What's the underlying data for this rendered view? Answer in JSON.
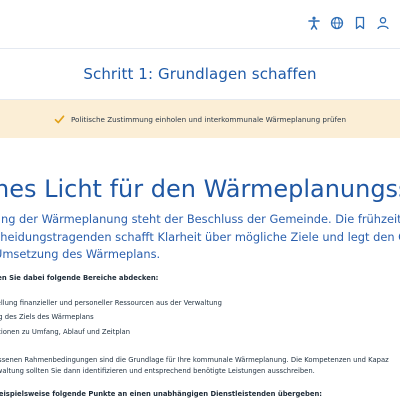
{
  "toolbar": {
    "icons": [
      "accessibility-icon",
      "globe-icon",
      "bookmark-icon",
      "user-icon"
    ]
  },
  "step": {
    "title": "Schritt 1: Grundlagen schaffen"
  },
  "banner": {
    "text": "Politische Zustimmung einholen und interkommunale Wärmeplanung prüfen"
  },
  "article": {
    "headline": "nes Licht für den Wärmeplanungsstart",
    "intro_lines": [
      "ang der Wärmeplanung steht der Beschluss der Gemeinde. Die frühzeitige Einbin",
      "cheidungstragenden schafft Klarheit über mögliche Ziele und legt den Grundste",
      "Umsetzung des Wärmeplans."
    ],
    "areas_heading": "ten Sie dabei folgende Bereiche abdecken:",
    "bullets": [
      "tellung finanzieller und personeller Ressourcen aus der Verwaltung",
      "ng des Ziels des Wärmeplans",
      "ationen zu Umfang, Ablauf und Zeitplan"
    ],
    "paragraph_lines": [
      "essenen Rahmenbedingungen sind die Grundlage für Ihre kommunale Wärmeplanung. Die Kompetenzen und Kapaz",
      "rwaltung sollten Sie dann identifizieren und entsprechend benötigte Leistungen ausschreiben."
    ],
    "handover_heading": "beispielsweise folgende Punkte an einen unabhängigen Dienstleistenden übergeben:"
  }
}
